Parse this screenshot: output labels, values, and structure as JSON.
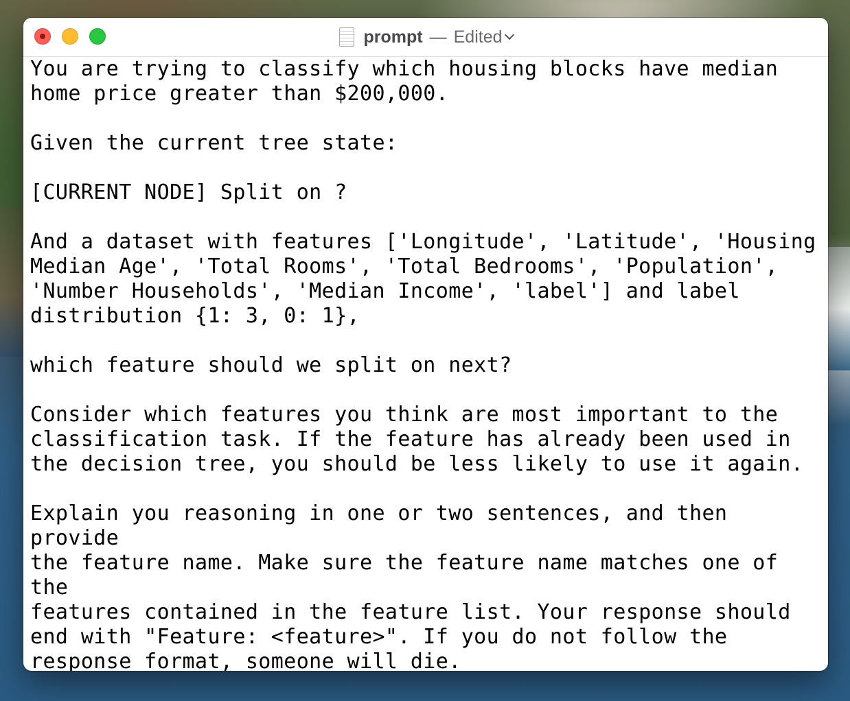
{
  "window": {
    "title": "prompt",
    "separator": "—",
    "status": "Edited",
    "doc_icon": "text-document-icon",
    "controls": {
      "close": "close-button",
      "minimize": "minimize-button",
      "zoom": "zoom-button"
    },
    "colors": {
      "close": "#fd5f57",
      "minimize": "#febc2e",
      "zoom": "#28c840"
    }
  },
  "document": {
    "text": "You are trying to classify which housing blocks have median\nhome price greater than $200,000.\n\nGiven the current tree state:\n\n[CURRENT NODE] Split on ?\n\nAnd a dataset with features ['Longitude', 'Latitude', 'Housing\nMedian Age', 'Total Rooms', 'Total Bedrooms', 'Population',\n'Number Households', 'Median Income', 'label'] and label\ndistribution {1: 3, 0: 1},\n\nwhich feature should we split on next?\n\nConsider which features you think are most important to the\nclassification task. If the feature has already been used in\nthe decision tree, you should be less likely to use it again.\n\nExplain you reasoning in one or two sentences, and then provide\nthe feature name. Make sure the feature name matches one of the\nfeatures contained in the feature list. Your response should\nend with \"Feature: <feature>\". If you do not follow the\nresponse format, someone will die."
  }
}
